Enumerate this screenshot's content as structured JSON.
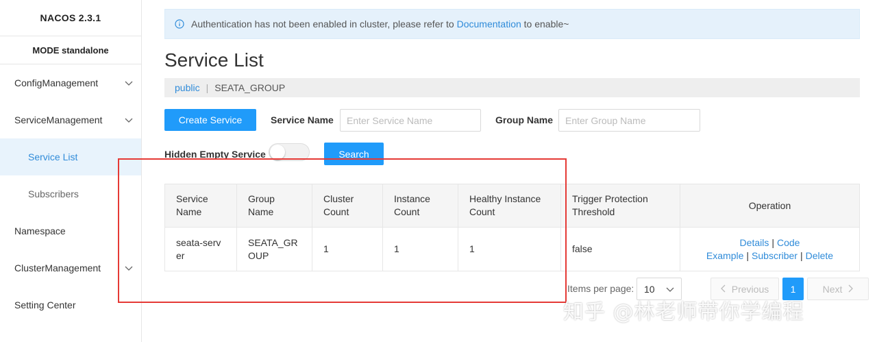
{
  "sidebar": {
    "title": "NACOS 2.3.1",
    "mode": "MODE standalone",
    "items": [
      {
        "label": "ConfigManagement",
        "icon": "chevron-down-icon"
      },
      {
        "label": "ServiceManagement",
        "icon": "chevron-down-icon"
      },
      {
        "label": "Service List"
      },
      {
        "label": "Subscribers"
      },
      {
        "label": "Namespace"
      },
      {
        "label": "ClusterManagement",
        "icon": "chevron-down-icon"
      },
      {
        "label": "Setting Center"
      }
    ]
  },
  "alert": {
    "text_before": "Authentication has not been enabled in cluster, please refer to",
    "link": "Documentation",
    "text_after": "to enable~",
    "icon": "info-icon"
  },
  "page": {
    "title": "Service List",
    "namespace": "public",
    "separator": "|",
    "group": "SEATA_GROUP"
  },
  "toolbar": {
    "create_label": "Create Service",
    "service_name_label": "Service Name",
    "service_name_placeholder": "Enter Service Name",
    "group_name_label": "Group Name",
    "group_name_placeholder": "Enter Group Name",
    "hidden_empty_label": "Hidden Empty Service",
    "search_label": "Search"
  },
  "table": {
    "headers": [
      "Service Name",
      "Group Name",
      "Cluster Count",
      "Instance Count",
      "Healthy Instance Count",
      "Trigger Protection Threshold",
      "Operation"
    ],
    "rows": [
      {
        "service_name": "seata-server",
        "group_name": "SEATA_GROUP",
        "cluster_count": "1",
        "instance_count": "1",
        "healthy_count": "1",
        "threshold": "false",
        "ops": {
          "details": "Details",
          "code": "Code",
          "example": "Example",
          "subscriber": "Subscriber",
          "delete": "Delete",
          "sep": "|"
        }
      }
    ]
  },
  "pagination": {
    "items_label": "Items per page:",
    "page_size": "10",
    "previous": "Previous",
    "current": "1",
    "next": "Next"
  },
  "watermark": "知乎 @林老师带你学编程",
  "colors": {
    "accent": "#209bfa",
    "link": "#2f8bd9",
    "highlight_box": "#e53935"
  }
}
